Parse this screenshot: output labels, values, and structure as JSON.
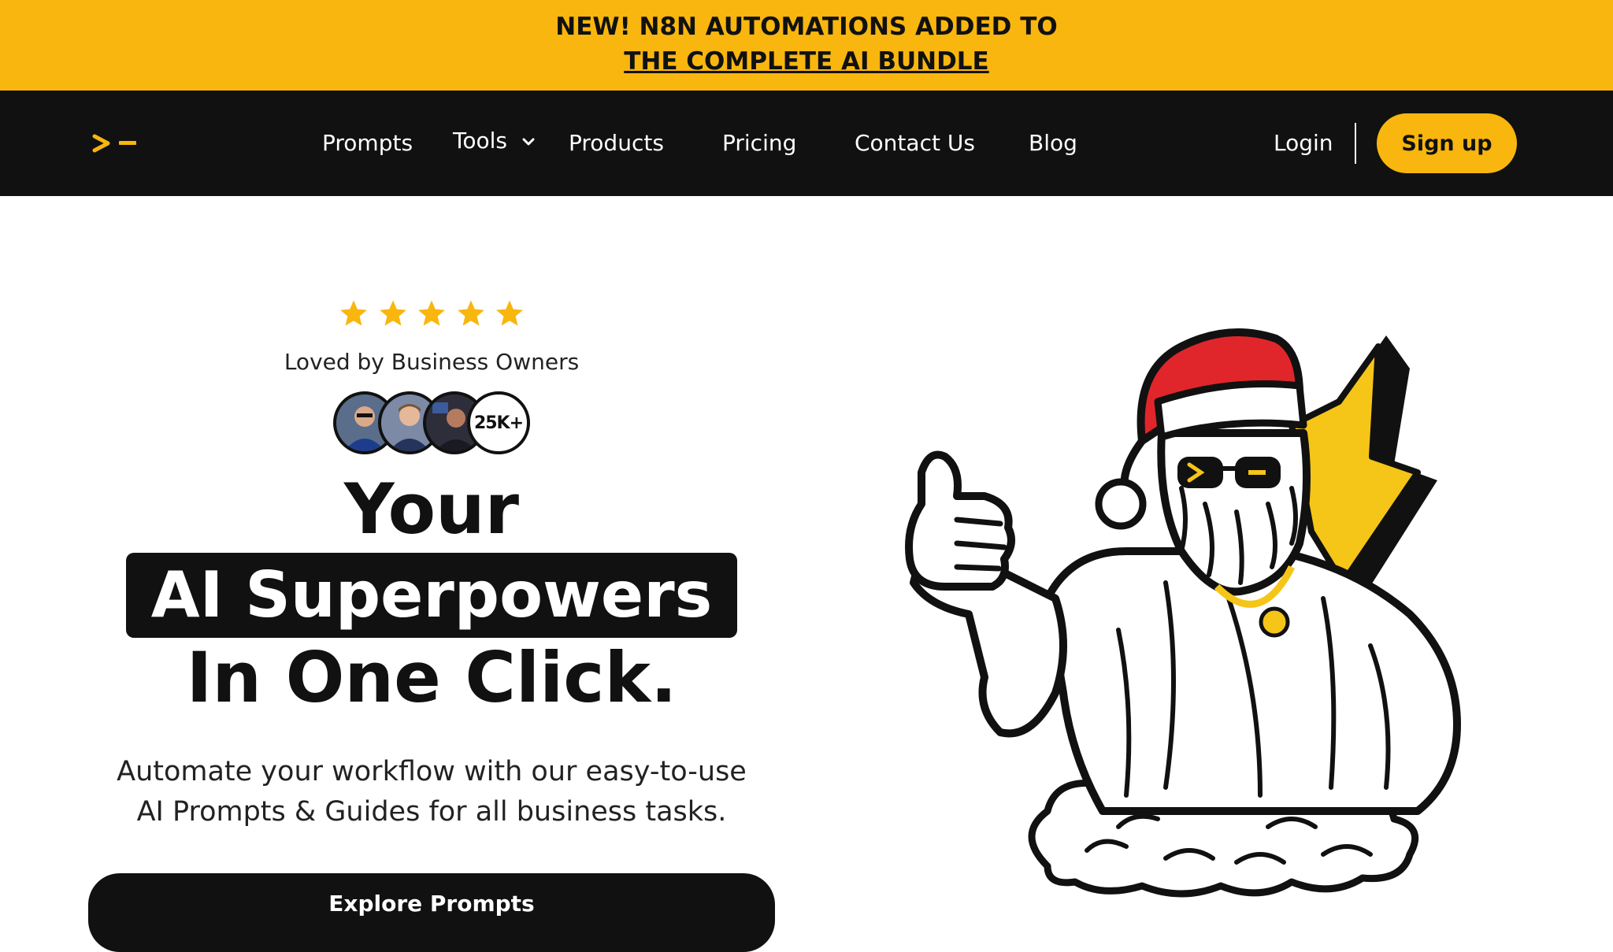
{
  "banner": {
    "line1": "NEW! N8N AUTOMATIONS ADDED TO",
    "line2": "THE COMPLETE AI BUNDLE"
  },
  "nav": {
    "items": [
      {
        "label": "Prompts"
      },
      {
        "label": "Tools"
      },
      {
        "label": "Products"
      },
      {
        "label": "Pricing"
      },
      {
        "label": "Contact Us"
      },
      {
        "label": "Blog"
      }
    ],
    "login": "Login",
    "signup": "Sign up"
  },
  "hero": {
    "rating_stars": 5,
    "loved_text": "Loved by Business Owners",
    "user_count": "25K+",
    "headline_line1": "Your",
    "headline_highlight": "AI Superpowers",
    "headline_line3": "In One Click.",
    "subtitle_line1": "Automate your workflow with our easy-to-use",
    "subtitle_line2": "AI Prompts & Guides for all business tasks.",
    "cta": "Explore Prompts"
  },
  "colors": {
    "accent": "#F8B60E",
    "dark": "#111111",
    "santa_red": "#E0262B"
  },
  "icons": [
    "terminal-logo-icon",
    "chevron-down-icon",
    "star-icon",
    "santa-mascot-illustration",
    "lightning-bolt-icon"
  ]
}
